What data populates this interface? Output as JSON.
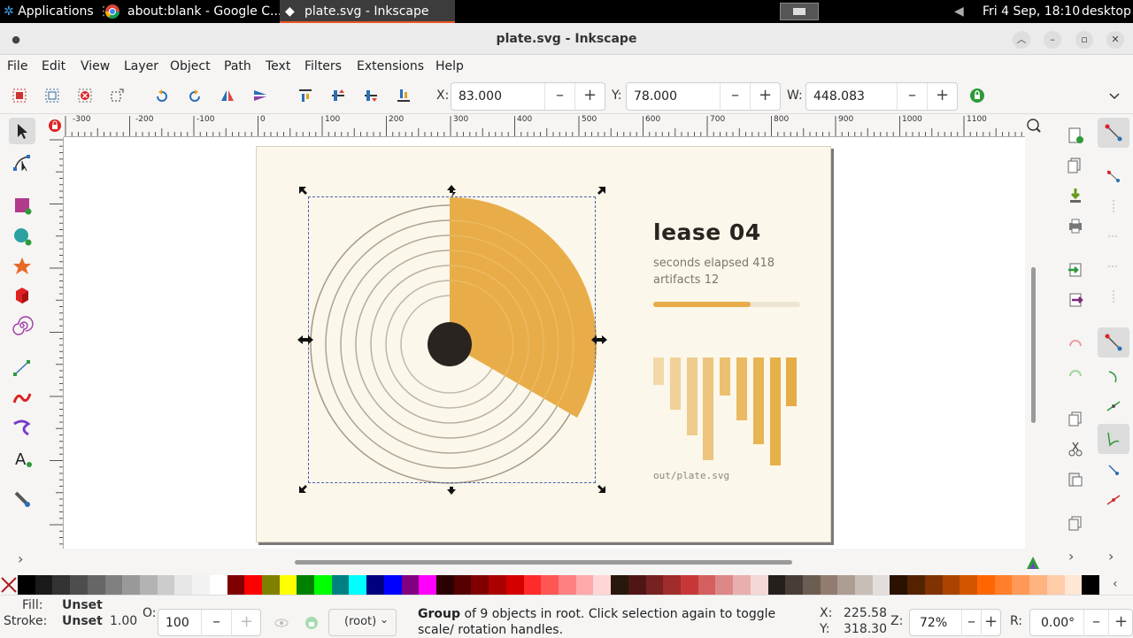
{
  "system_bar": {
    "applications": "Applications",
    "tab1": "about:blank - Google C...",
    "tab2": "plate.svg - Inkscape",
    "datetime": "Fri 4 Sep, 18:10",
    "desktop": "desktop"
  },
  "window": {
    "title": "plate.svg - Inkscape"
  },
  "menu": [
    "File",
    "Edit",
    "View",
    "Layer",
    "Object",
    "Path",
    "Text",
    "Filters",
    "Extensions",
    "Help"
  ],
  "toolbar": {
    "x_label": "X:",
    "x_value": "83.000",
    "y_label": "Y:",
    "y_value": "78.000",
    "w_label": "W:",
    "w_value": "448.083",
    "minus": "–",
    "plus": "+"
  },
  "ruler": {
    "labels": [
      "-300",
      "-200",
      "-100",
      "0",
      "100",
      "200",
      "300",
      "400",
      "500",
      "600",
      "700",
      "800",
      "900",
      "1000",
      "1100"
    ]
  },
  "artwork": {
    "heading": "lease 04",
    "line1": "seconds elapsed 418",
    "line2": "artifacts 12",
    "progress": 0.66,
    "footer": "out/plate.svg",
    "bars": [
      {
        "top": 0.0,
        "height": 0.25,
        "shade": "#f3d9a8"
      },
      {
        "top": 0.0,
        "height": 0.48,
        "shade": "#f1d19a"
      },
      {
        "top": 0.0,
        "height": 0.72,
        "shade": "#efcb8d"
      },
      {
        "top": 0.0,
        "height": 0.95,
        "shade": "#edc47e"
      },
      {
        "top": 0.0,
        "height": 0.35,
        "shade": "#ecc06f"
      },
      {
        "top": 0.0,
        "height": 0.58,
        "shade": "#e9ba62"
      },
      {
        "top": 0.0,
        "height": 0.8,
        "shade": "#e8b555"
      },
      {
        "top": 0.0,
        "height": 1.0,
        "shade": "#e6b04a"
      },
      {
        "top": 0.0,
        "height": 0.45,
        "shade": "#e5ad45"
      }
    ],
    "colors": {
      "accent": "#e8ad49",
      "bg": "#fbf7ea",
      "ring": "#a59a88",
      "dark": "#2a2420"
    }
  },
  "palette_colors": [
    "#000000",
    "#1a1a1a",
    "#333333",
    "#4d4d4d",
    "#666666",
    "#808080",
    "#999999",
    "#b3b3b3",
    "#cccccc",
    "#e6e6e6",
    "#f2f2f2",
    "#ffffff",
    "#800000",
    "#ff0000",
    "#808000",
    "#ffff00",
    "#008000",
    "#00ff00",
    "#008080",
    "#00ffff",
    "#000080",
    "#0000ff",
    "#800080",
    "#ff00ff",
    "#2b0000",
    "#550000",
    "#800000",
    "#aa0000",
    "#d40000",
    "#ff2a2a",
    "#ff5555",
    "#ff8080",
    "#ffaaaa",
    "#ffd5d5",
    "#28170b",
    "#501616",
    "#782121",
    "#a02c2c",
    "#c83737",
    "#d35f5f",
    "#de8787",
    "#e9afaf",
    "#f4d7d7",
    "#241f1c",
    "#483e37",
    "#6c5d53",
    "#917c6f",
    "#ac9d93",
    "#c8beb7",
    "#e3dedb",
    "#2b1100",
    "#552200",
    "#803300",
    "#aa4400",
    "#d45500",
    "#ff6600",
    "#ff7f2a",
    "#ff9955",
    "#ffb380",
    "#ffccaa",
    "#ffe6d5",
    "#000000"
  ],
  "status": {
    "fill_label": "Fill:",
    "fill_value": "Unset",
    "stroke_label": "Stroke:",
    "stroke_value": "Unset",
    "stroke_width": "1.00",
    "opacity_label": "O:",
    "opacity_value": "100",
    "layer": "(root)",
    "message_bold": "Group",
    "message": " of 9 objects in root. Click selection again to toggle scale/ rotation handles.",
    "cx_label": "X:",
    "cx": "225.58",
    "cy_label": "Y:",
    "cy": "318.30",
    "zoom_label": "Z:",
    "zoom": "72%",
    "rot_label": "R:",
    "rot": "0.00°"
  }
}
